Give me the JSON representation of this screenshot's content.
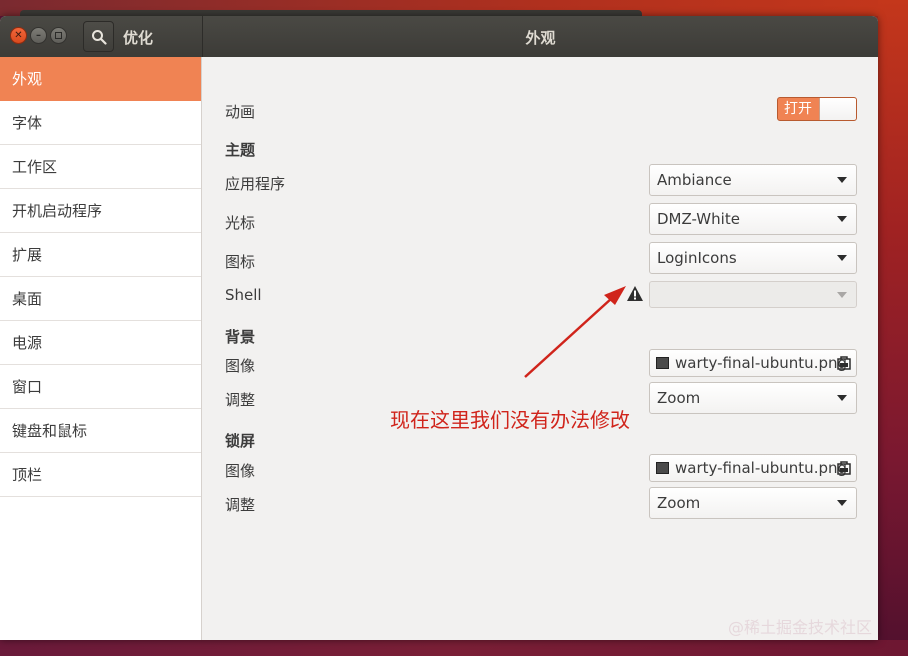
{
  "app": {
    "title": "优化",
    "page_title": "外观"
  },
  "sidebar": {
    "items": [
      {
        "label": "外观",
        "active": true
      },
      {
        "label": "字体"
      },
      {
        "label": "工作区"
      },
      {
        "label": "开机启动程序"
      },
      {
        "label": "扩展"
      },
      {
        "label": "桌面"
      },
      {
        "label": "电源"
      },
      {
        "label": "窗口"
      },
      {
        "label": "键盘和鼠标"
      },
      {
        "label": "顶栏"
      }
    ]
  },
  "appearance": {
    "animation_label": "动画",
    "animation_toggle": "打开",
    "theme_heading": "主题",
    "applications_label": "应用程序",
    "applications_value": "Ambiance",
    "cursor_label": "光标",
    "cursor_value": "DMZ-White",
    "icons_label": "图标",
    "icons_value": "LoginIcons",
    "shell_label": "Shell",
    "shell_value": "",
    "background_heading": "背景",
    "background_image_label": "图像",
    "background_image_value": "warty-final-ubuntu.png",
    "background_adjust_label": "调整",
    "background_adjust_value": "Zoom",
    "lockscreen_heading": "锁屏",
    "lockscreen_image_label": "图像",
    "lockscreen_image_value": "warty-final-ubuntu.png",
    "lockscreen_adjust_label": "调整",
    "lockscreen_adjust_value": "Zoom"
  },
  "annotation": {
    "text": "现在这里我们没有办法修改",
    "color": "#d0241b"
  },
  "watermark": "@稀土掘金技术社区",
  "colors": {
    "accent": "#f08353",
    "titlebar": "#3c3b37",
    "close_button": "#e95420"
  }
}
